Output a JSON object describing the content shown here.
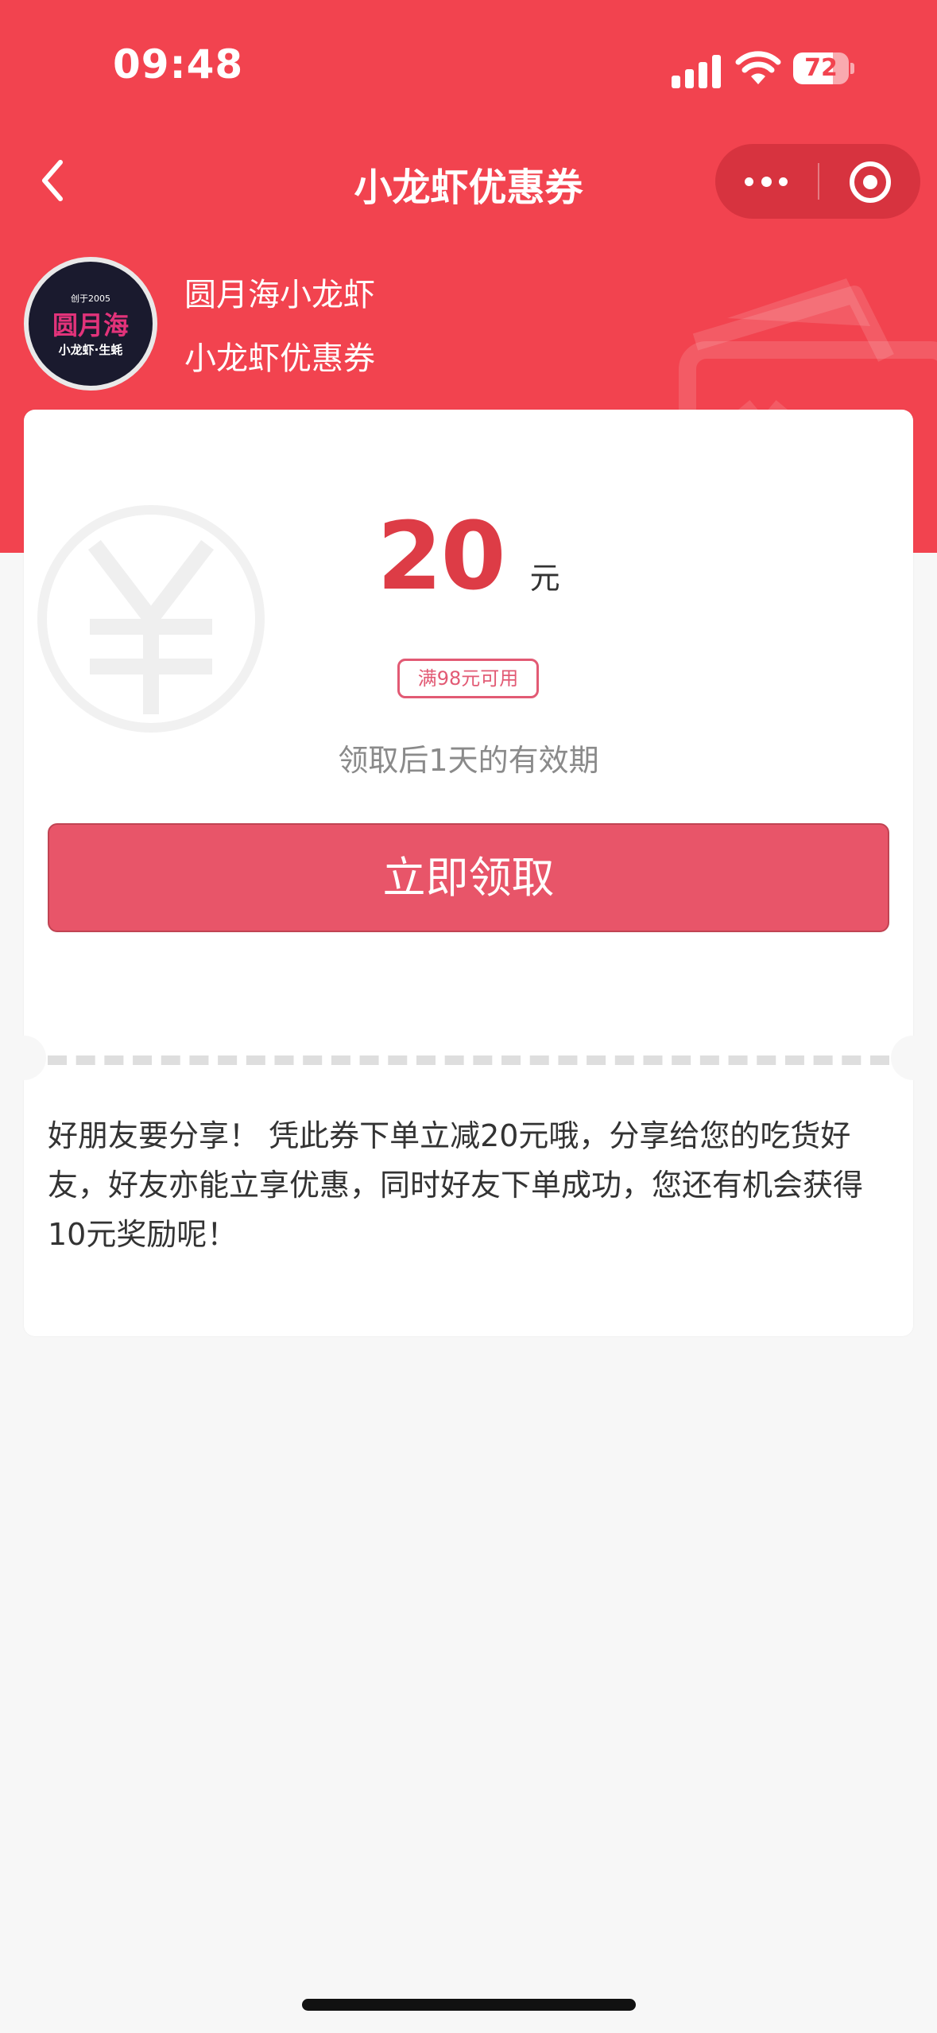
{
  "status_bar": {
    "time": "09:48",
    "battery_level": "72",
    "battery_fraction": 0.72
  },
  "nav": {
    "title": "小龙虾优惠券"
  },
  "store": {
    "logo_lines": [
      "创于2005",
      "圆月海",
      "小龙虾·生蚝"
    ],
    "name": "圆月海小龙虾",
    "coupon_name": "小龙虾优惠券"
  },
  "coupon": {
    "amount": "20",
    "unit": "元",
    "condition": "满98元可用",
    "validity": "领取后1天的有效期",
    "claim_label": "立即领取",
    "description": "好朋友要分享！ 凭此券下单立减20元哦，分享给您的吃货好友，好友亦能立享优惠，同时好友下单成功，您还有机会获得10元奖励呢！"
  },
  "colors": {
    "header_red": "#f2434f",
    "amount_red": "#dd3c46",
    "button_pink": "#e85569",
    "tag_pink": "#e25a74",
    "page_bg": "#f7f7f7"
  },
  "icons": [
    "back-chevron-icon",
    "more-dots-icon",
    "close-target-icon",
    "signal-icon",
    "wifi-icon",
    "battery-icon",
    "yen-coin-icon",
    "wallet-icon"
  ]
}
